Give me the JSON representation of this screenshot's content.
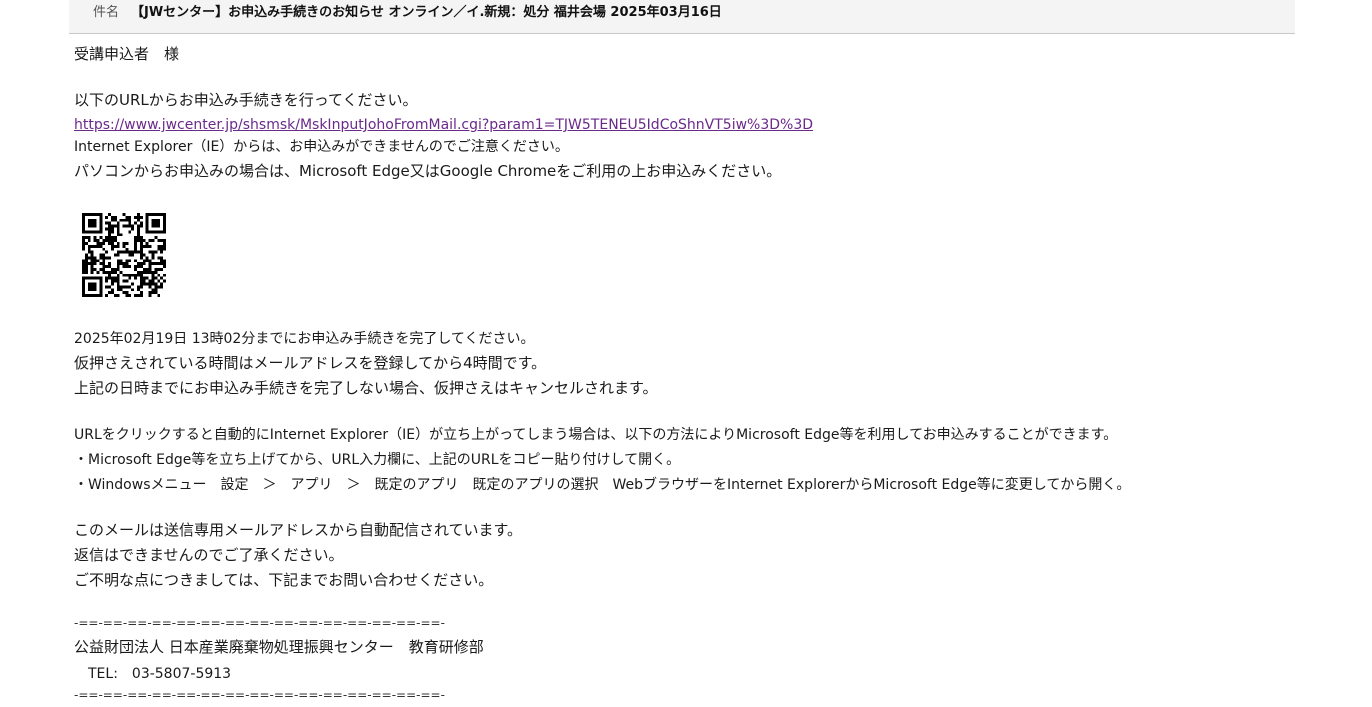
{
  "header": {
    "subject_label": "件名",
    "subject_text": "【JWセンター】お申込み手続きのお知らせ オンライン／イ.新規：処分 福井会場 2025年03月16日"
  },
  "email": {
    "greeting": "受講申込者　様",
    "instruction": "以下のURLからお申込み手続きを行ってください。",
    "url": "https://www.jwcenter.jp/shsmsk/MskInputJohoFromMail.cgi?param1=TJW5TENEU5IdCoShnVT5iw%3D%3D",
    "ie_note": "Internet Explorer（IE）からは、お申込みができませんのでご注意ください。",
    "browser_note": "パソコンからお申込みの場合は、Microsoft Edge又はGoogle Chromeをご利用の上お申込みください。",
    "deadline": "2025年02月19日 13時02分までにお申込み手続きを完了してください。",
    "hold_note": "仮押さえされている時間はメールアドレスを登録してから4時間です。",
    "cancel_note": "上記の日時までにお申込み手続きを完了しない場合、仮押さえはキャンセルされます。",
    "ie_launch_note": "URLをクリックすると自動的にInternet Explorer（IE）が立ち上がってしまう場合は、以下の方法によりMicrosoft Edge等を利用してお申込みすることができます。",
    "method1": "・Microsoft Edge等を立ち上げてから、URL入力欄に、上記のURLをコピー貼り付けして開く。",
    "method2": "・Windowsメニュー　設定　＞　アプリ　＞　既定のアプリ　既定のアプリの選択　WebブラウザーをInternet ExplorerからMicrosoft Edge等に変更してから開く。",
    "auto_note": "このメールは送信専用メールアドレスから自動配信されています。",
    "no_reply": "返信はできませんのでご了承ください。",
    "contact_note": "ご不明な点につきましては、下記までお問い合わせください。",
    "separator": "-==-==-==-==-==-==-==-==-==-==-==-==-==-==-==-",
    "org": "公益財団法人 日本産業廃棄物処理振興センター　教育研修部",
    "tel": "　TEL:　03-5807-5913"
  }
}
